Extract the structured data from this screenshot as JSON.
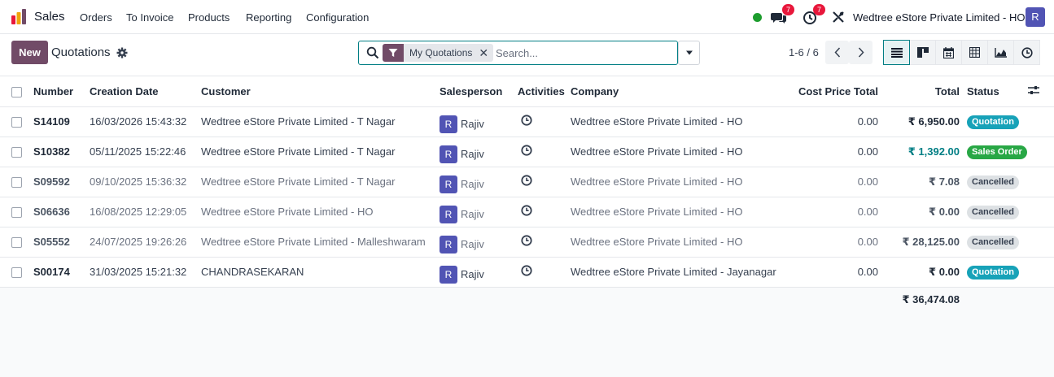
{
  "topbar": {
    "app_name": "Sales",
    "menu": [
      "Orders",
      "To Invoice",
      "Products",
      "Reporting",
      "Configuration"
    ],
    "messages_count": "7",
    "activities_count": "7",
    "company": "Wedtree eStore Private Limited - HO",
    "user_initial": "R",
    "presence_color": "#1d9d2e"
  },
  "control": {
    "new_label": "New",
    "title": "Quotations",
    "facet_label": "My Quotations",
    "search_placeholder": "Search...",
    "pager": "1-6 / 6",
    "views": [
      "list-icon",
      "kanban-icon",
      "calendar-icon",
      "pivot-icon",
      "graph-icon",
      "activity-icon"
    ]
  },
  "table": {
    "columns": {
      "number": "Number",
      "creation_date": "Creation Date",
      "customer": "Customer",
      "salesperson": "Salesperson",
      "activities": "Activities",
      "company": "Company",
      "cost_price_total": "Cost Price Total",
      "total": "Total",
      "status": "Status"
    },
    "rows": [
      {
        "number": "S14109",
        "date": "16/03/2026 15:43:32",
        "customer": "Wedtree eStore Private Limited - T Nagar",
        "sp_initial": "R",
        "salesperson": "Rajiv",
        "company": "Wedtree eStore Private Limited - HO",
        "cost": "0.00",
        "total": "₹ 6,950.00",
        "status": "Quotation"
      },
      {
        "number": "S10382",
        "date": "05/11/2025 15:22:46",
        "customer": "Wedtree eStore Private Limited - T Nagar",
        "sp_initial": "R",
        "salesperson": "Rajiv",
        "company": "Wedtree eStore Private Limited - HO",
        "cost": "0.00",
        "total": "₹ 1,392.00",
        "status": "Sales Order"
      },
      {
        "number": "S09592",
        "date": "09/10/2025 15:36:32",
        "customer": "Wedtree eStore Private Limited - T Nagar",
        "sp_initial": "R",
        "salesperson": "Rajiv",
        "company": "Wedtree eStore Private Limited - HO",
        "cost": "0.00",
        "total": "₹ 7.08",
        "status": "Cancelled"
      },
      {
        "number": "S06636",
        "date": "16/08/2025 12:29:05",
        "customer": "Wedtree eStore Private Limited - HO",
        "sp_initial": "R",
        "salesperson": "Rajiv",
        "company": "Wedtree eStore Private Limited - HO",
        "cost": "0.00",
        "total": "₹ 0.00",
        "status": "Cancelled"
      },
      {
        "number": "S05552",
        "date": "24/07/2025 19:26:26",
        "customer": "Wedtree eStore Private Limited - Malleshwaram",
        "sp_initial": "R",
        "salesperson": "Rajiv",
        "company": "Wedtree eStore Private Limited - HO",
        "cost": "0.00",
        "total": "₹ 28,125.00",
        "status": "Cancelled"
      },
      {
        "number": "S00174",
        "date": "31/03/2025 15:21:32",
        "customer": "CHANDRASEKARAN",
        "sp_initial": "R",
        "salesperson": "Rajiv",
        "company": "Wedtree eStore Private Limited - Jayanagar",
        "cost": "0.00",
        "total": "₹ 0.00",
        "status": "Quotation"
      }
    ],
    "grand_total": "₹ 36,474.08"
  },
  "colors": {
    "brand": "#714b67",
    "accent": "#017e84",
    "quotation_badge": "#17a2b8",
    "sales_order_badge": "#28a745",
    "cancelled_badge": "#dde1e4",
    "notification_badge": "#e8173b"
  }
}
